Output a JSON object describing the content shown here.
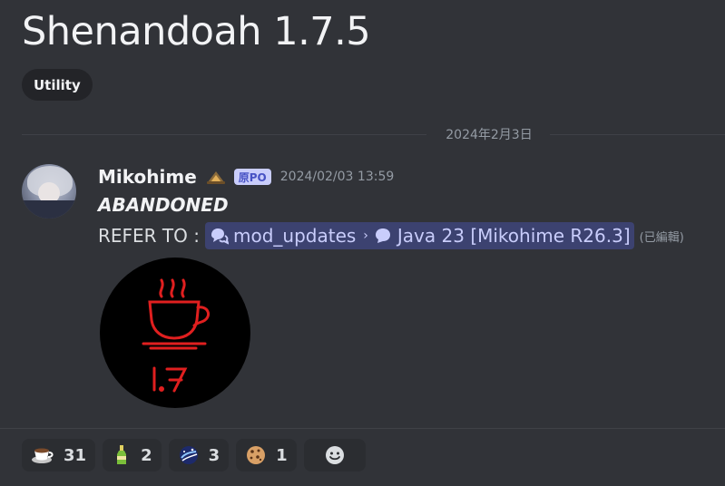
{
  "thread": {
    "title": "Shenandoah 1.7.5",
    "tag": "Utility"
  },
  "divider": {
    "date": "2024年2月3日"
  },
  "message": {
    "username": "Mikohime",
    "op_badge": "原PO",
    "timestamp": "2024/02/03 13:59",
    "line1": "ABANDONED",
    "refer_label": "REFER TO :",
    "channel_mention": "mod_updates",
    "thread_mention": "Java 23 [Mikohime R26.3]",
    "edited": "(已編輯)",
    "attachment_text": "1.7"
  },
  "reactions": [
    {
      "icon": "coffee-cup-icon",
      "count": "31"
    },
    {
      "icon": "bottle-icon",
      "count": "2"
    },
    {
      "icon": "galaxy-icon",
      "count": "3"
    },
    {
      "icon": "cookie-icon",
      "count": "1"
    }
  ],
  "colors": {
    "background": "#313338",
    "mention_bg": "#3c4270",
    "mention_text": "#c9cdfb",
    "coffee_red": "#e01f1f"
  }
}
